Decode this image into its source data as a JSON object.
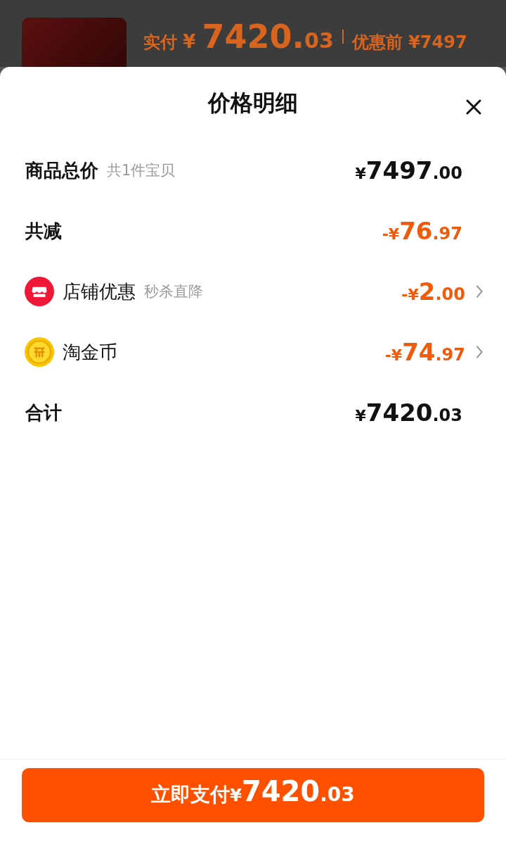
{
  "background_order": {
    "paid_label": "实付",
    "paid_currency": "¥",
    "paid_main": "7420.",
    "paid_fraction": "03",
    "before_label": "优惠前",
    "before_price": "¥7497"
  },
  "sheet": {
    "title": "价格明细",
    "rows": [
      {
        "kind": "plain",
        "label": "商品总价",
        "note": "共1件宝贝",
        "price": {
          "prefix": "¥",
          "main": "7497",
          "fraction": ".00"
        },
        "discount": false,
        "has_detail": false
      },
      {
        "kind": "plain",
        "label": "共减",
        "price": {
          "prefix": "-¥",
          "main": "76",
          "fraction": ".97"
        },
        "discount": true,
        "has_detail": false
      },
      {
        "kind": "shop",
        "label": "店铺优惠",
        "note": "秒杀直降",
        "price": {
          "prefix": "-¥",
          "main": "2",
          "fraction": ".00"
        },
        "discount": true,
        "has_detail": true
      },
      {
        "kind": "coin",
        "label": "淘金币",
        "price": {
          "prefix": "-¥",
          "main": "74",
          "fraction": ".97"
        },
        "discount": true,
        "has_detail": true
      },
      {
        "kind": "plain",
        "label": "合计",
        "price": {
          "prefix": "¥",
          "main": "7420",
          "fraction": ".03"
        },
        "discount": false,
        "has_detail": false
      }
    ],
    "pay_button": {
      "label": "立即支付",
      "prefix": "¥",
      "main": "7420",
      "fraction": ".03"
    }
  }
}
